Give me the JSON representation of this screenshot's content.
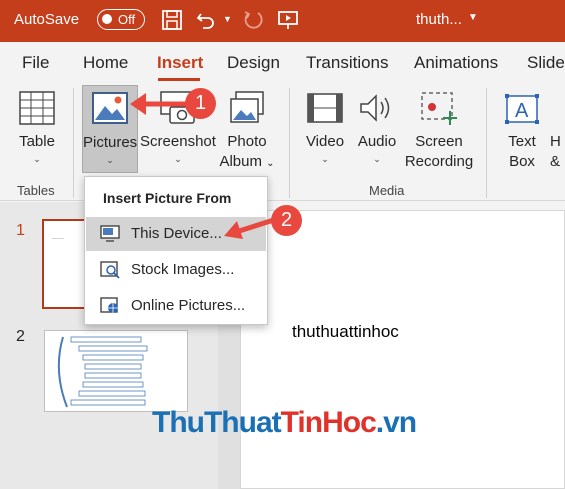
{
  "titlebar": {
    "autosave_label": "AutoSave",
    "toggle_state": "Off",
    "doc_title": "thuth...",
    "bg_color": "#c43e1c"
  },
  "tabs": [
    {
      "label": "File"
    },
    {
      "label": "Home"
    },
    {
      "label": "Insert",
      "active": true
    },
    {
      "label": "Design"
    },
    {
      "label": "Transitions"
    },
    {
      "label": "Animations"
    },
    {
      "label": "Slide"
    }
  ],
  "ribbon": {
    "table": {
      "label": "Table",
      "icon": "table-icon"
    },
    "pictures": {
      "label": "Pictures",
      "icon": "pictures-icon"
    },
    "screenshot": {
      "label": "Screenshot",
      "icon": "screenshot-icon"
    },
    "photo_album": {
      "line1": "Photo",
      "line2": "Album",
      "icon": "photo-album-icon"
    },
    "video": {
      "label": "Video",
      "icon": "video-icon"
    },
    "audio": {
      "label": "Audio",
      "icon": "audio-icon"
    },
    "screen_recording": {
      "line1": "Screen",
      "line2": "Recording",
      "icon": "screen-recording-icon"
    },
    "text_box": {
      "line1": "Text",
      "line2": "Box",
      "icon": "text-box-icon"
    },
    "partial": {
      "line1": "H",
      "line2": "&"
    },
    "groups": {
      "tables": "Tables",
      "media": "Media"
    }
  },
  "dropdown": {
    "header": "Insert Picture From",
    "items": [
      {
        "label": "This Device...",
        "icon": "this-device-icon",
        "highlighted": true
      },
      {
        "label": "Stock Images...",
        "icon": "stock-images-icon"
      },
      {
        "label": "Online Pictures...",
        "icon": "online-pictures-icon"
      }
    ]
  },
  "slides": {
    "items": [
      {
        "number": "1",
        "selected": true
      },
      {
        "number": "2"
      }
    ],
    "main_text": "thuthuattinhoc"
  },
  "annotations": {
    "badge1": "1",
    "badge2": "2"
  },
  "watermark": {
    "part1": "ThuThuat",
    "part2": "TinHoc",
    "part3": ".vn"
  }
}
